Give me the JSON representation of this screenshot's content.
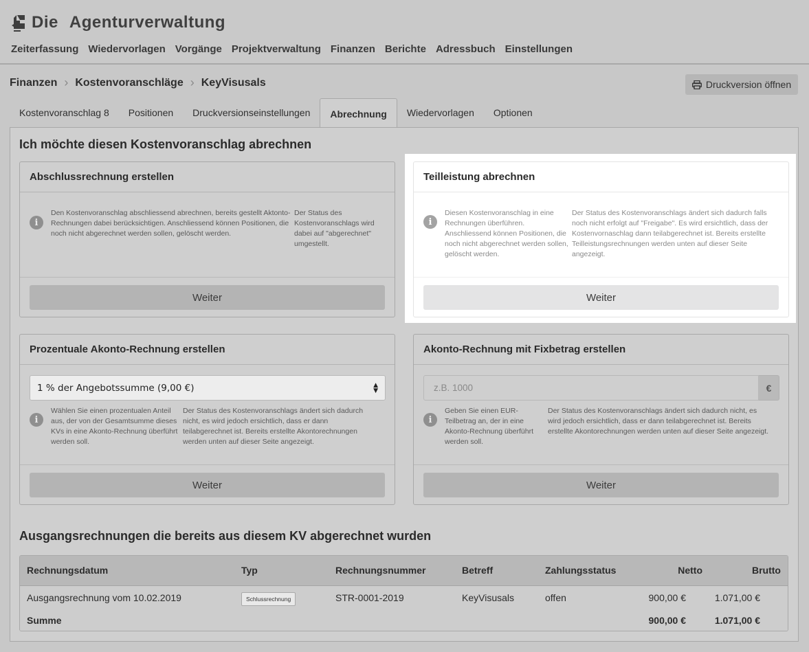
{
  "app": {
    "brand_word1": "Die",
    "brand_word2": "Agenturverwaltung"
  },
  "mainnav": [
    "Zeiterfassung",
    "Wiedervorlagen",
    "Vorgänge",
    "Projektverwaltung",
    "Finanzen",
    "Berichte",
    "Adressbuch",
    "Einstellungen"
  ],
  "breadcrumb": [
    "Finanzen",
    "Kostenvoranschläge",
    "KeyVisusals"
  ],
  "print_button": {
    "label": "Druckversion öffnen",
    "icon": "printer-icon"
  },
  "tabs": [
    {
      "label": "Kostenvoranschlag 8",
      "active": false
    },
    {
      "label": "Positionen",
      "active": false
    },
    {
      "label": "Druckversionseinstellungen",
      "active": false
    },
    {
      "label": "Abrechnung",
      "active": true
    },
    {
      "label": "Wiedervorlagen",
      "active": false
    },
    {
      "label": "Optionen",
      "active": false
    }
  ],
  "section_title": "Ich möchte diesen Kostenvoranschlag abrechnen",
  "cards": {
    "abschluss": {
      "title": "Abschlussrechnung erstellen",
      "text1": "Den Kostenvoranschlag abschliessend abrechnen, bereits gestellt Aktonto-Rechnungen dabei berücksichtigen. Anschliessend können Positionen, die noch nicht abgerechnet werden sollen, gelöscht werden.",
      "text2": "Der Status des Kostenvoranschlags wird dabei auf \"abgerechnet\" umgestellt.",
      "button": "Weiter"
    },
    "teilleistung": {
      "title": "Teilleistung abrechnen",
      "text1": "Diesen Kostenvoranschlag in eine Rechnungen überführen. Anschliessend können Positionen, die noch nicht abgerechnet werden sollen, gelöscht werden.",
      "text2": "Der Status des Kostenvoranschlags ändert sich dadurch falls noch nicht erfolgt auf \"Freigabe\". Es wird ersichtlich, dass der Kostenvornaschlag dann teilabgerechnet ist. Bereits erstellte Teilleistungsrechnungen werden unten auf dieser Seite angezeigt.",
      "button": "Weiter"
    },
    "prozentual": {
      "title": "Prozentuale Akonto-Rechnung erstellen",
      "select_value": "1 % der Angebotssumme (9,00 €)",
      "text1": "Wählen Sie einen prozentualen Anteil aus, der von der Gesamtsumme dieses KVs in eine Akonto-Rechnung überführt werden soll.",
      "text2": "Der Status des Kostenvoranschlags ändert sich dadurch nicht, es wird jedoch ersichtlich, dass er dann teilabgerechnet ist. Bereits erstellte Akontorechnungen werden unten auf dieser Seite angezeigt.",
      "button": "Weiter"
    },
    "fixbetrag": {
      "title": "Akonto-Rechnung mit Fixbetrag erstellen",
      "input_placeholder": "z.B. 1000",
      "input_addon": "€",
      "text1": "Geben Sie einen EUR-Teilbetrag an, der in eine Akonto-Rechnung überführt werden soll.",
      "text2": "Der Status des Kostenvoranschlags ändert sich dadurch nicht, es wird jedoch ersichtlich, dass er dann teilabgerechnet ist. Bereits erstellte Akontorechnungen werden unten auf dieser Seite angezeigt.",
      "button": "Weiter"
    }
  },
  "invoices": {
    "title": "Ausgangsrechnungen die bereits aus diesem KV abgerechnet wurden",
    "columns": [
      "Rechnungsdatum",
      "Typ",
      "Rechnungsnummer",
      "Betreff",
      "Zahlungsstatus",
      "Netto",
      "Brutto"
    ],
    "rows": [
      {
        "datum": "Ausgangsrechnung vom 10.02.2019",
        "typ": "Schlussrechnung",
        "nummer": "STR-0001-2019",
        "betreff": "KeyVisusals",
        "status": "offen",
        "netto": "900,00 €",
        "brutto": "1.071,00 €"
      }
    ],
    "sum": {
      "label": "Summe",
      "netto": "900,00 €",
      "brutto": "1.071,00 €"
    }
  }
}
